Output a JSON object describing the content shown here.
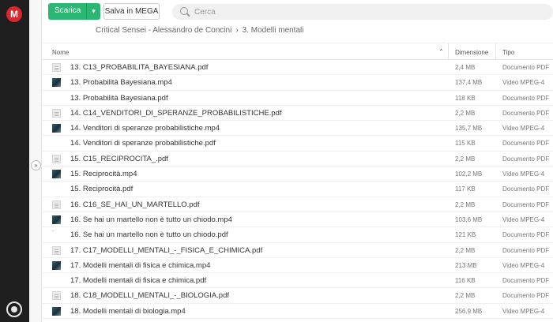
{
  "app": {
    "logo_text": "M"
  },
  "toolbar": {
    "download_label": "Scarica",
    "save_label": "Salva in MEGA",
    "search_placeholder": "Cerca"
  },
  "breadcrumb": {
    "parent": "Critical Sensei - Alessandro de Concini",
    "separator": "›",
    "current": "3. Modelli mentali"
  },
  "table": {
    "headers": {
      "name": "Nome",
      "size": "Dimensione",
      "type": "Tipo"
    },
    "rows": [
      {
        "name": "13. C13_PROBABILITA_BAYESIANA.pdf",
        "size": "2,4 MB",
        "type": "Documento PDF",
        "thumb": "pdf"
      },
      {
        "name": "13. Probabilità Bayesiana.mp4",
        "size": "137,4 MB",
        "type": "Video MPEG-4",
        "thumb": "video"
      },
      {
        "name": "13. Probabilità Bayesiana.pdf",
        "size": "118 KB",
        "type": "Documento PDF",
        "thumb": "none"
      },
      {
        "name": "14. C14_VENDITORI_DI_SPERANZE_PROBABILISTICHE.pdf",
        "size": "2,2 MB",
        "type": "Documento PDF",
        "thumb": "pdf"
      },
      {
        "name": "14. Venditori di speranze probabilistiche.mp4",
        "size": "135,7 MB",
        "type": "Video MPEG-4",
        "thumb": "video"
      },
      {
        "name": "14. Venditori di speranze probabilistiche.pdf",
        "size": "115 KB",
        "type": "Documento PDF",
        "thumb": "none"
      },
      {
        "name": "15. C15_RECIPROCITA_.pdf",
        "size": "2,2 MB",
        "type": "Documento PDF",
        "thumb": "pdf"
      },
      {
        "name": "15. Reciprocità.mp4",
        "size": "102,2 MB",
        "type": "Video MPEG-4",
        "thumb": "video"
      },
      {
        "name": "15. Reciprocità.pdf",
        "size": "117 KB",
        "type": "Documento PDF",
        "thumb": "none"
      },
      {
        "name": "16. C16_SE_HAI_UN_MARTELLO.pdf",
        "size": "2,2 MB",
        "type": "Documento PDF",
        "thumb": "pdf"
      },
      {
        "name": "16. Se hai un martello non è tutto un chiodo.mp4",
        "size": "103,6 MB",
        "type": "Video MPEG-4",
        "thumb": "video"
      },
      {
        "name": "16. Se hai un martello non è tutto un chiodo.pdf",
        "size": "121 KB",
        "type": "Documento PDF",
        "thumb": "blank"
      },
      {
        "name": "17. C17_MODELLI_MENTALI_-_FISICA_E_CHIMICA.pdf",
        "size": "2,2 MB",
        "type": "Documento PDF",
        "thumb": "pdf"
      },
      {
        "name": "17. Modelli mentali di fisica e chimica.mp4",
        "size": "213 MB",
        "type": "Video MPEG-4",
        "thumb": "video"
      },
      {
        "name": "17. Modelli mentali di fisica e chimica.pdf",
        "size": "116 KB",
        "type": "Documento PDF",
        "thumb": "none"
      },
      {
        "name": "18. C18_MODELLI_MENTALI_-_BIOLOGIA.pdf",
        "size": "2,2 MB",
        "type": "Documento PDF",
        "thumb": "pdf"
      },
      {
        "name": "18. Modelli mentali di biologia.mp4",
        "size": "256,9 MB",
        "type": "Video MPEG-4",
        "thumb": "video"
      }
    ]
  },
  "colors": {
    "brand": "#d9272e",
    "download": "#2bb673",
    "sidebar": "#1f1f1f"
  }
}
